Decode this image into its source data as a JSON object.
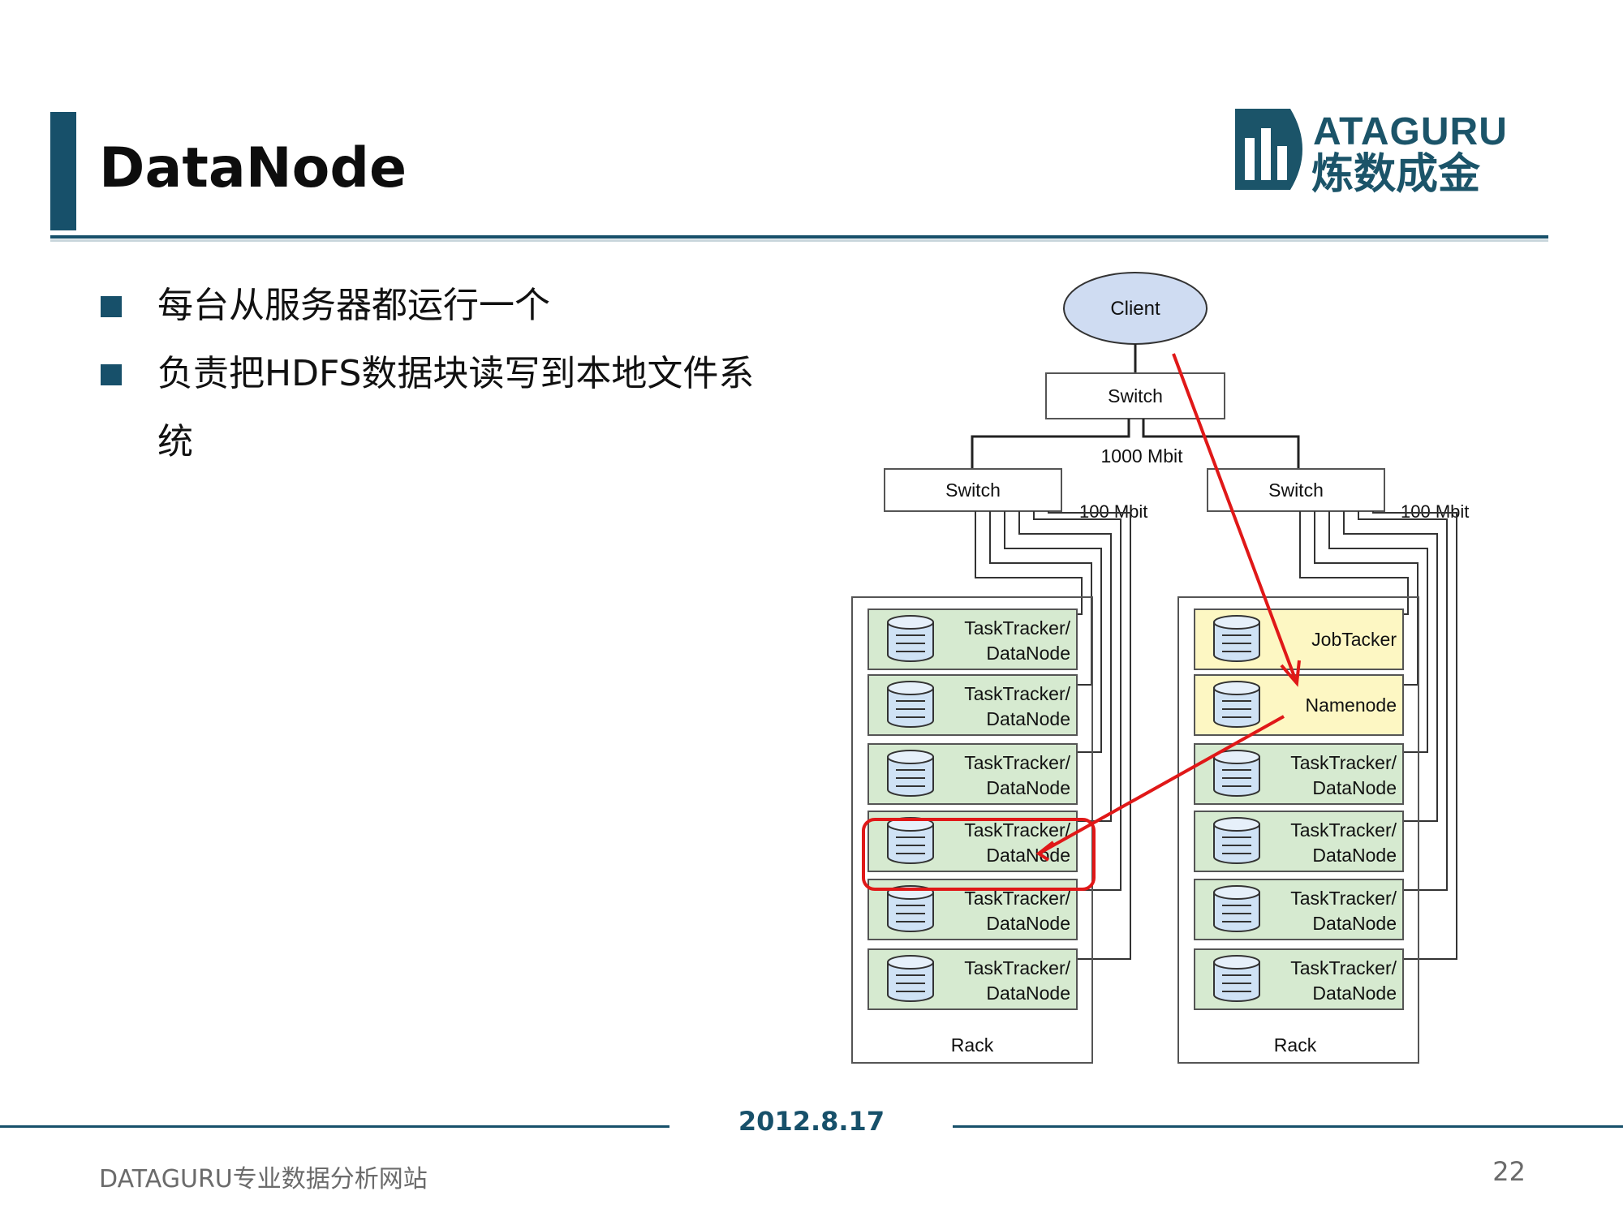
{
  "slide": {
    "title": "DataNode",
    "bullets": [
      "每台从服务器都运行一个",
      "负责把HDFS数据块读写到本地文件系统"
    ],
    "logo": {
      "latin": "ATAGURU",
      "cn": "炼数成金"
    },
    "footer": {
      "date": "2012.8.17",
      "site": "DATAGURU专业数据分析网站",
      "page": "22"
    }
  },
  "diagram": {
    "client": "Client",
    "core_switch": "Switch",
    "core_link": "1000 Mbit",
    "rack_switches": [
      {
        "label": "Switch",
        "link": "100 Mbit"
      },
      {
        "label": "Switch",
        "link": "100 Mbit"
      }
    ],
    "racks": [
      {
        "label": "Rack",
        "nodes": [
          {
            "line1": "TaskTracker/",
            "line2": "DataNode"
          },
          {
            "line1": "TaskTracker/",
            "line2": "DataNode"
          },
          {
            "line1": "TaskTracker/",
            "line2": "DataNode"
          },
          {
            "line1": "TaskTracker/",
            "line2": "DataNode"
          },
          {
            "line1": "TaskTracker/",
            "line2": "DataNode"
          },
          {
            "line1": "TaskTracker/",
            "line2": "DataNode"
          }
        ]
      },
      {
        "label": "Rack",
        "nodes": [
          {
            "line1": "JobTacker",
            "line2": ""
          },
          {
            "line1": "Namenode",
            "line2": ""
          },
          {
            "line1": "TaskTracker/",
            "line2": "DataNode"
          },
          {
            "line1": "TaskTracker/",
            "line2": "DataNode"
          },
          {
            "line1": "TaskTracker/",
            "line2": "DataNode"
          },
          {
            "line1": "TaskTracker/",
            "line2": "DataNode"
          }
        ]
      }
    ],
    "colors": {
      "datanode": "#d6ead0",
      "master": "#fdf7c3",
      "client": "#cfdcf2",
      "highlight": "#e01818",
      "accent": "#17506a"
    }
  }
}
